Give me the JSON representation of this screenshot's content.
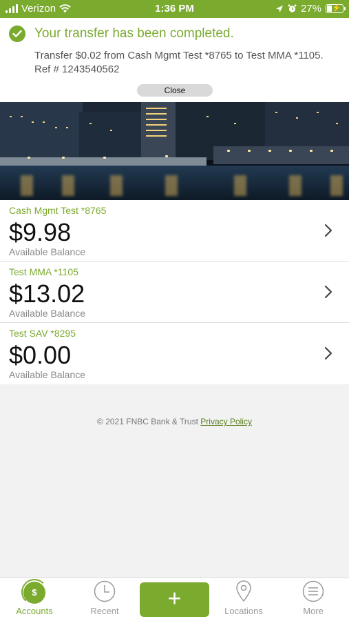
{
  "status_bar": {
    "carrier": "Verizon",
    "time": "1:36 PM",
    "battery": "27%"
  },
  "notification": {
    "title": "Your transfer has been completed.",
    "message": "Transfer $0.02 from Cash Mgmt Test *8765 to Test MMA *1105. Ref # 1243540562",
    "close_label": "Close"
  },
  "accounts": [
    {
      "name": "Cash Mgmt Test *8765",
      "balance": "$9.98",
      "sub": "Available Balance"
    },
    {
      "name": "Test MMA *1105",
      "balance": "$13.02",
      "sub": "Available Balance"
    },
    {
      "name": "Test SAV *8295",
      "balance": "$0.00",
      "sub": "Available Balance"
    }
  ],
  "footer": {
    "copyright": "© 2021 FNBC Bank & Trust",
    "privacy_link": "Privacy Policy"
  },
  "tabbar": {
    "accounts_label": "Accounts",
    "accounts_icon_glyph": "$",
    "recent_label": "Recent",
    "locations_label": "Locations",
    "more_label": "More",
    "active_tab": "Accounts"
  },
  "colors": {
    "brand_green": "#7aaa2e",
    "link_green": "#5a7f1f"
  }
}
